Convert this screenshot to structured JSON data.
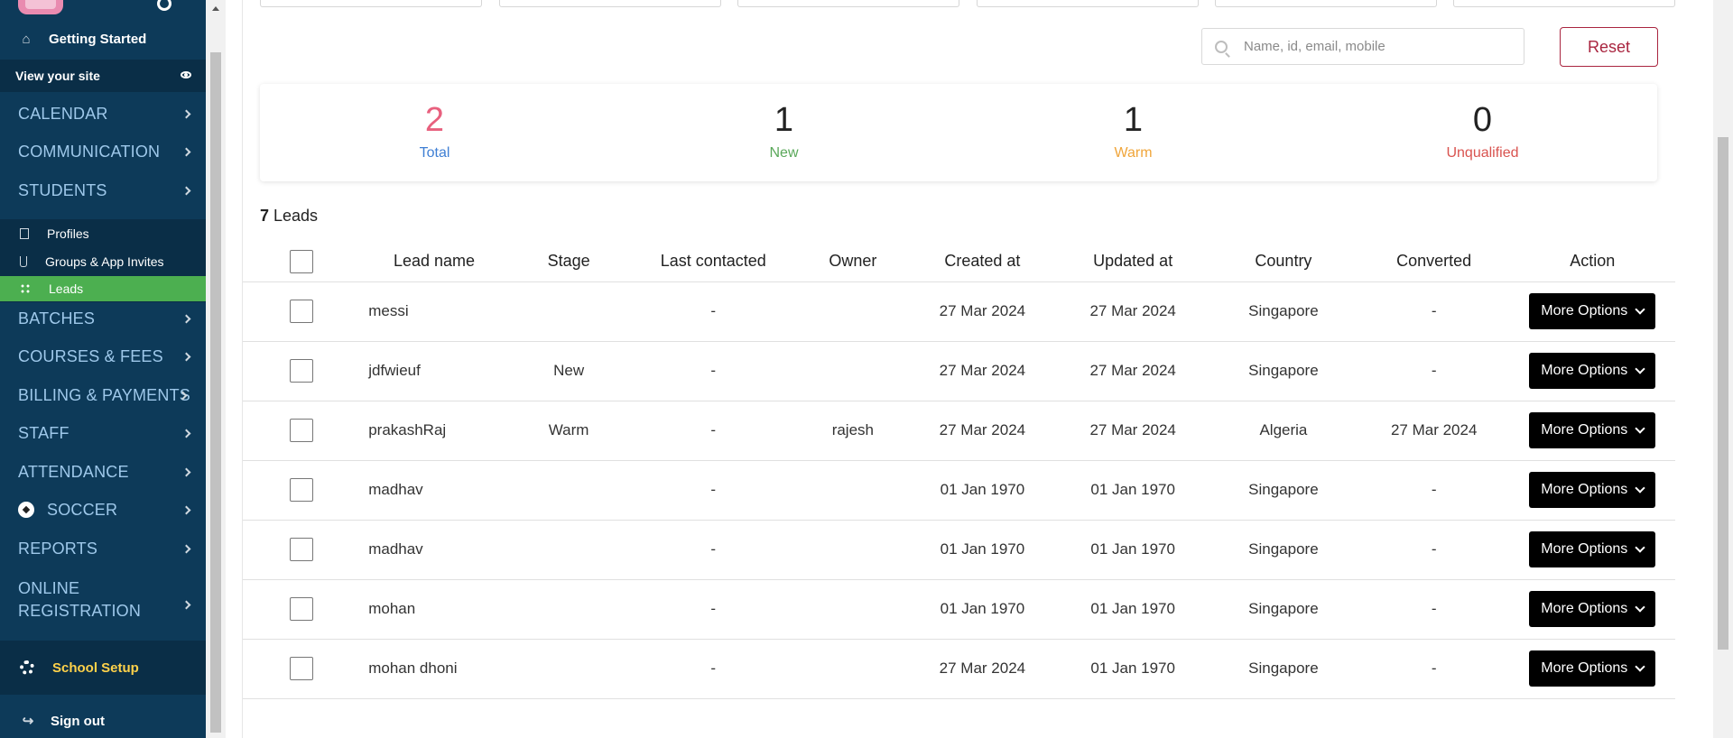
{
  "sidebar": {
    "getting_started": "Getting Started",
    "view_site": "View your site",
    "nav": [
      {
        "label": "CALENDAR"
      },
      {
        "label": "COMMUNICATION"
      },
      {
        "label": "STUDENTS"
      }
    ],
    "students_sub": [
      {
        "label": "Profiles"
      },
      {
        "label": "Groups & App Invites"
      },
      {
        "label": "Leads"
      }
    ],
    "nav2": [
      {
        "label": "BATCHES"
      },
      {
        "label": "COURSES & FEES"
      },
      {
        "label": "BILLING & PAYMENTS"
      },
      {
        "label": "STAFF"
      },
      {
        "label": "ATTENDANCE"
      },
      {
        "label": "SOCCER"
      },
      {
        "label": "REPORTS"
      },
      {
        "label": "ONLINE"
      },
      {
        "label": "REGISTRATION"
      }
    ],
    "school_setup": "School Setup",
    "sign_out": "Sign out"
  },
  "search": {
    "placeholder": "Name, id, email, mobile"
  },
  "reset_label": "Reset",
  "stats": [
    {
      "value": "2",
      "label": "Total",
      "num_color": "#e8607e",
      "label_color": "#3f7fd4"
    },
    {
      "value": "1",
      "label": "New",
      "num_color": "#222222",
      "label_color": "#5aa85a"
    },
    {
      "value": "1",
      "label": "Warm",
      "num_color": "#222222",
      "label_color": "#f0a53a"
    },
    {
      "value": "0",
      "label": "Unqualified",
      "num_color": "#222222",
      "label_color": "#d9534f"
    }
  ],
  "leads_count": {
    "count": "7",
    "label": " Leads"
  },
  "table": {
    "headers": [
      "Lead name",
      "Stage",
      "Last contacted",
      "Owner",
      "Created at",
      "Updated at",
      "Country",
      "Converted",
      "Action"
    ],
    "rows": [
      {
        "name": "messi",
        "stage": "",
        "last": "-",
        "owner": "",
        "created": "27 Mar 2024",
        "updated": "27 Mar 2024",
        "country": "Singapore",
        "converted": "-"
      },
      {
        "name": "jdfwieuf",
        "stage": "New",
        "last": "-",
        "owner": "",
        "created": "27 Mar 2024",
        "updated": "27 Mar 2024",
        "country": "Singapore",
        "converted": "-"
      },
      {
        "name": "prakashRaj",
        "stage": "Warm",
        "last": "-",
        "owner": "rajesh",
        "created": "27 Mar 2024",
        "updated": "27 Mar 2024",
        "country": "Algeria",
        "converted": "27 Mar 2024"
      },
      {
        "name": "madhav",
        "stage": "",
        "last": "-",
        "owner": "",
        "created": "01 Jan 1970",
        "updated": "01 Jan 1970",
        "country": "Singapore",
        "converted": "-"
      },
      {
        "name": "madhav",
        "stage": "",
        "last": "-",
        "owner": "",
        "created": "01 Jan 1970",
        "updated": "01 Jan 1970",
        "country": "Singapore",
        "converted": "-"
      },
      {
        "name": "mohan",
        "stage": "",
        "last": "-",
        "owner": "",
        "created": "01 Jan 1970",
        "updated": "01 Jan 1970",
        "country": "Singapore",
        "converted": "-"
      },
      {
        "name": "mohan dhoni",
        "stage": "",
        "last": "-",
        "owner": "",
        "created": "27 Mar 2024",
        "updated": "01 Jan 1970",
        "country": "Singapore",
        "converted": "-"
      }
    ],
    "action_label": "More Options"
  }
}
